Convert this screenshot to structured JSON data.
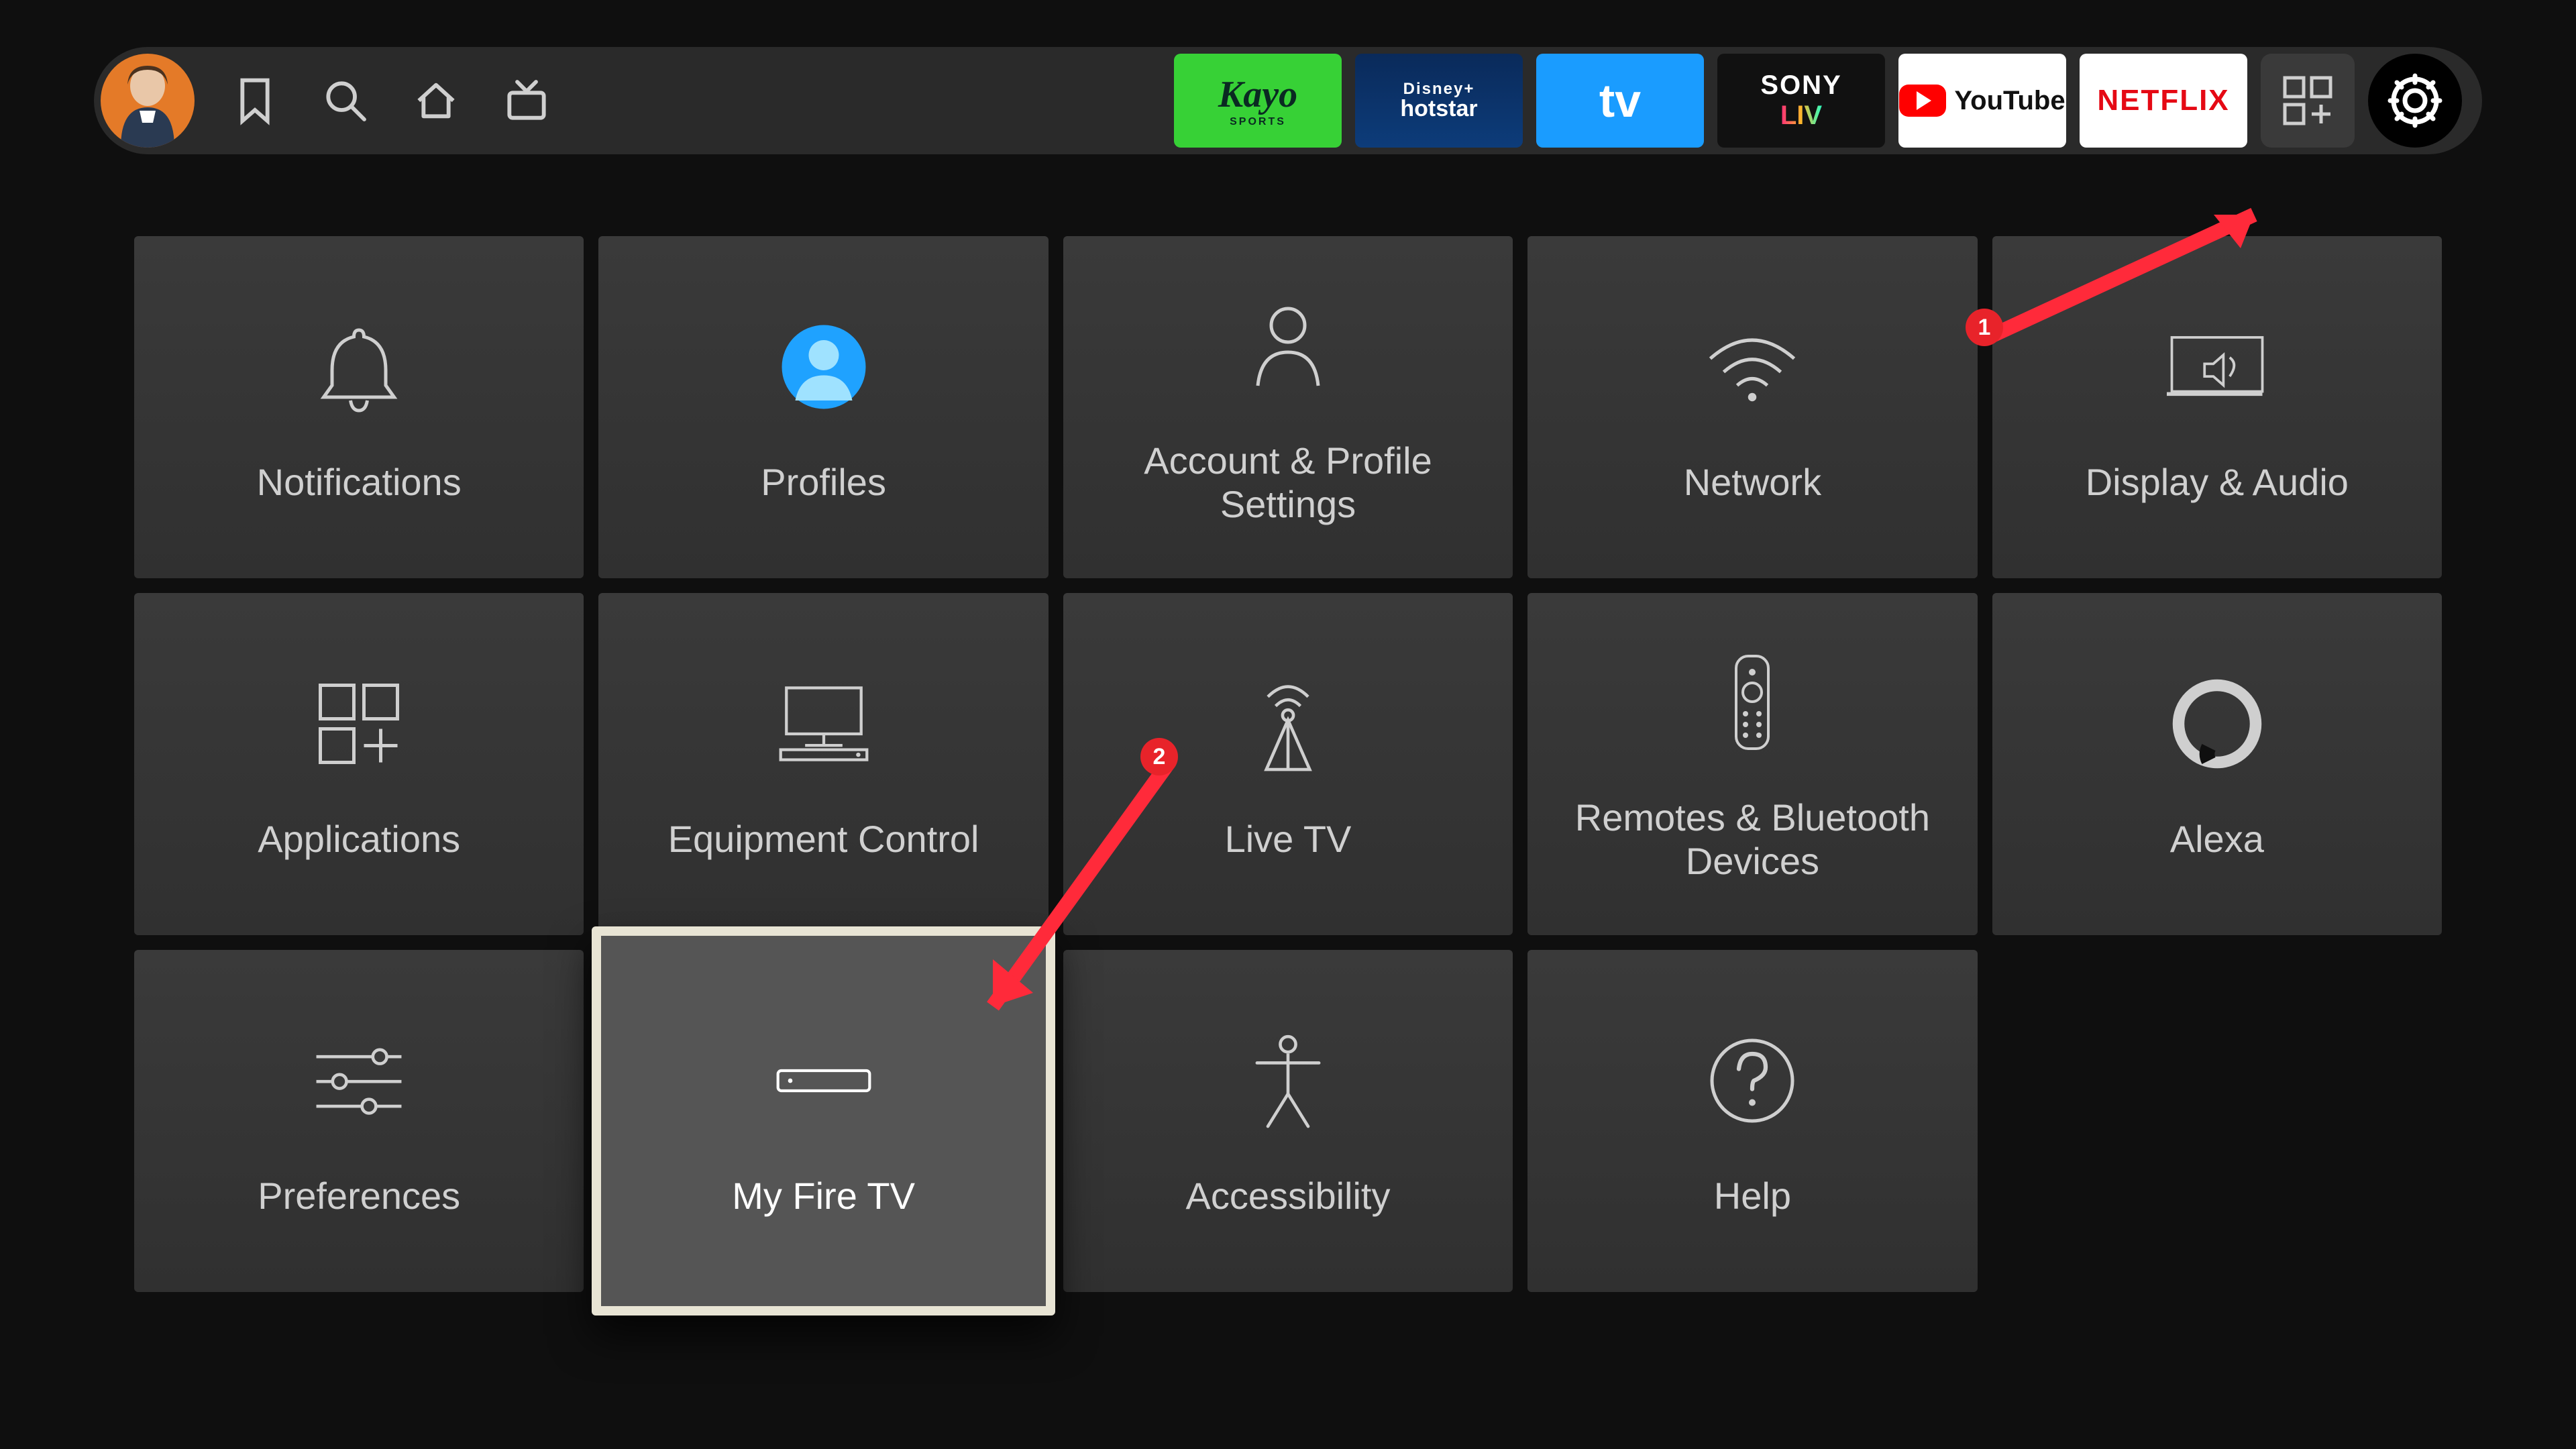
{
  "nav": {
    "apps": [
      {
        "id": "kayo",
        "label": "Kayo",
        "sub": "SPORTS"
      },
      {
        "id": "hotstar",
        "label": "Disney+",
        "sub": "hotstar"
      },
      {
        "id": "tv",
        "label": "tv"
      },
      {
        "id": "sonyliv",
        "label": "SONY",
        "sub": "LIV"
      },
      {
        "id": "youtube",
        "label": "YouTube"
      },
      {
        "id": "netflix",
        "label": "NETFLIX"
      }
    ]
  },
  "settings_tiles": [
    {
      "id": "notifications",
      "label": "Notifications",
      "icon": "bell"
    },
    {
      "id": "profiles",
      "label": "Profiles",
      "icon": "profile"
    },
    {
      "id": "account",
      "label": "Account & Profile Settings",
      "icon": "person"
    },
    {
      "id": "network",
      "label": "Network",
      "icon": "wifi"
    },
    {
      "id": "display-audio",
      "label": "Display & Audio",
      "icon": "monitor"
    },
    {
      "id": "applications",
      "label": "Applications",
      "icon": "apps"
    },
    {
      "id": "equipment",
      "label": "Equipment Control",
      "icon": "tv-stand"
    },
    {
      "id": "live-tv",
      "label": "Live TV",
      "icon": "antenna"
    },
    {
      "id": "remotes",
      "label": "Remotes & Bluetooth Devices",
      "icon": "remote"
    },
    {
      "id": "alexa",
      "label": "Alexa",
      "icon": "alexa"
    },
    {
      "id": "preferences",
      "label": "Preferences",
      "icon": "sliders"
    },
    {
      "id": "my-fire-tv",
      "label": "My Fire TV",
      "icon": "device",
      "selected": true
    },
    {
      "id": "accessibility",
      "label": "Accessibility",
      "icon": "a11y"
    },
    {
      "id": "help",
      "label": "Help",
      "icon": "help"
    }
  ],
  "annotations": {
    "badge1": "1",
    "badge2": "2"
  }
}
